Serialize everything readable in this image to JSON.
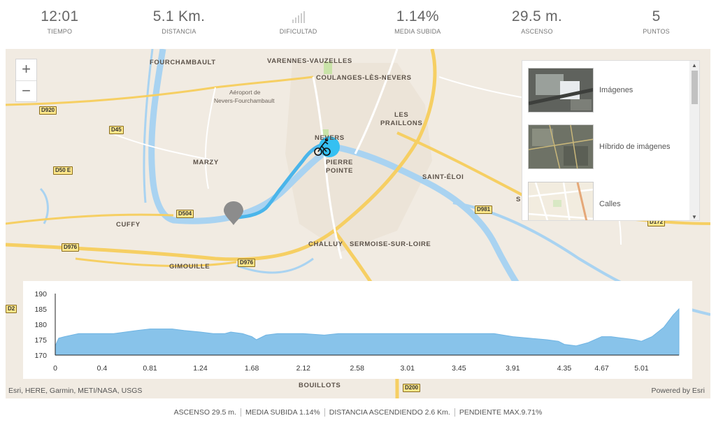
{
  "stats": [
    {
      "value": "12:01",
      "label": "TIEMPO"
    },
    {
      "value": "5.1 Km.",
      "label": "DISTANCIA"
    },
    {
      "value": "",
      "label": "DIFICULTAD"
    },
    {
      "value": "1.14%",
      "label": "MEDIA SUBIDA"
    },
    {
      "value": "29.5 m.",
      "label": "ASCENSO"
    },
    {
      "value": "5",
      "label": "PUNTOS"
    }
  ],
  "difficulty": {
    "bars_total": 5,
    "bars_on": 0
  },
  "map": {
    "zoom_in": "+",
    "zoom_out": "−",
    "places": {
      "fourchambault": "FOURCHAMBAULT",
      "varennes": "VARENNES-VAUZELLES",
      "coulanges": "COULANGES-LÈS-NEVERS",
      "aeroport1": "Aéroport de",
      "aeroport2": "Nevers-Fourchambault",
      "les": "LES",
      "praillons": "PRAILLONS",
      "nevers": "NEVERS",
      "marzy": "MARZY",
      "pierre": "PIERRE",
      "pointe": "POINTE",
      "saint_eloi": "SAINT-ÉLOI",
      "cuffy": "CUFFY",
      "challuy": "CHALLUY",
      "sermoise": "SERMOISE-SUR-LOIRE",
      "gimouille": "GIMOUILLE",
      "bouillots": "BOUILLOTS",
      "s_cut": "S"
    },
    "roads": {
      "d920": "D920",
      "d45": "D45",
      "d50e": "D50 E",
      "d504": "D504",
      "d976a": "D976",
      "d976b": "D976",
      "d981": "D981",
      "d172": "D172",
      "d200": "D200",
      "d2": "D2"
    },
    "attribution_left": "Esri, HERE, Garmin, METI/NASA, USGS",
    "attribution_right": "Powered by Esri",
    "basemaps": [
      {
        "label": "Imágenes"
      },
      {
        "label": "Híbrido de imágenes"
      },
      {
        "label": "Calles"
      }
    ]
  },
  "chart_data": {
    "type": "area",
    "title": "",
    "xlabel": "",
    "ylabel": "",
    "x_ticks": [
      "0",
      "0.4",
      "0.81",
      "1.24",
      "1.68",
      "2.12",
      "2.58",
      "3.01",
      "3.45",
      "3.91",
      "4.35",
      "4.67",
      "5.01"
    ],
    "y_ticks": [
      "190",
      "185",
      "180",
      "175",
      "170"
    ],
    "ylim": [
      170,
      190
    ],
    "xlim": [
      0,
      5.33
    ],
    "series": [
      {
        "x": [
          0,
          0.03,
          0.08,
          0.2,
          0.24,
          0.36,
          0.5,
          0.6,
          0.7,
          0.81,
          0.9,
          1.0,
          1.1,
          1.24,
          1.35,
          1.45,
          1.5,
          1.6,
          1.68,
          1.72,
          1.8,
          1.9,
          2.0,
          2.12,
          2.3,
          2.42,
          2.5,
          2.58,
          2.7,
          2.9,
          3.01,
          3.2,
          3.45,
          3.6,
          3.75,
          3.91,
          4.05,
          4.2,
          4.3,
          4.35,
          4.45,
          4.55,
          4.67,
          4.75,
          4.85,
          4.95,
          5.01,
          5.1,
          5.2,
          5.28,
          5.33
        ],
        "values": [
          173,
          175.5,
          176,
          177,
          177,
          177,
          177,
          177.5,
          178,
          178.5,
          178.5,
          178.5,
          178,
          177.5,
          177,
          177,
          177.5,
          177,
          176,
          175,
          176.5,
          177,
          177,
          177,
          176.5,
          177,
          177,
          177,
          177,
          177,
          177,
          177,
          177,
          177,
          177,
          176,
          175.5,
          175,
          174.5,
          173.5,
          173,
          174,
          176,
          176,
          175.5,
          175,
          174.5,
          176,
          179,
          183,
          185
        ]
      }
    ]
  },
  "summary": {
    "ascenso": "ASCENSO 29.5 m.",
    "media": "MEDIA SUBIDA 1.14%",
    "distancia": "DISTANCIA ASCENDIENDO 2.6 Km.",
    "pendiente": "PENDIENTE MAX.9.71%"
  }
}
